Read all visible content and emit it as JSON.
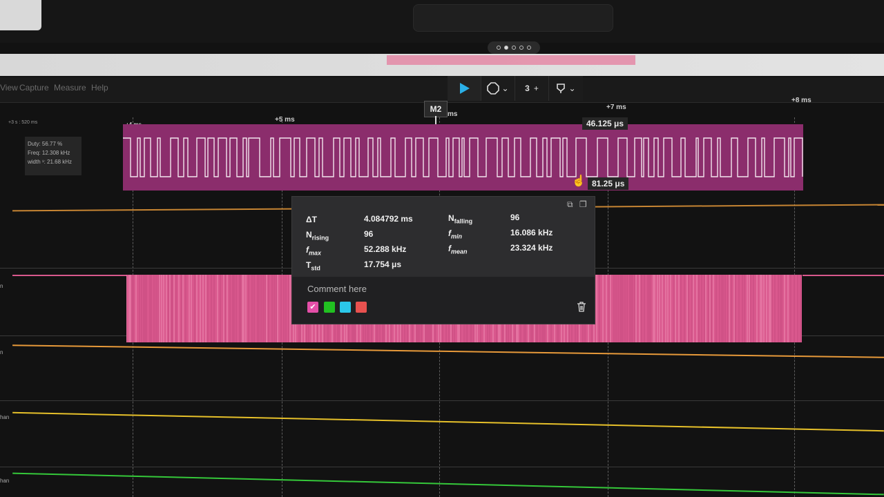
{
  "menu": [
    "View",
    "Capture",
    "Measure",
    "Help"
  ],
  "toolbar": {
    "trigger_label": "ᵀ",
    "step_label": "3",
    "plus_label": "+",
    "chevron": "⌄"
  },
  "ruler": {
    "ticks": [
      "+4 ms",
      "+5 ms",
      "ms",
      "+7 ms",
      "+8 ms"
    ],
    "left_label": "+3 s : 520 ms"
  },
  "marker": {
    "label": "M2"
  },
  "measurements": {
    "pulse_width": "46.125 μs",
    "period": "81.25 μs"
  },
  "left_box": {
    "duty": "Duty: 56.77 %",
    "freq": "Freq: 12.308 kHz",
    "width": "width ¹: 21.68 kHz"
  },
  "popup": {
    "delta_t_label": "ΔT",
    "delta_t": "4.084792 ms",
    "n_falling_label": "N",
    "n_falling_sub": "falling",
    "n_falling": "96",
    "n_rising_label": "N",
    "n_rising_sub": "rising",
    "n_rising": "96",
    "f_min_label": "f",
    "f_min_sub": "min",
    "f_min": "16.086 kHz",
    "f_max_label": "f",
    "f_max_sub": "max",
    "f_max": "52.288 kHz",
    "f_mean_label": "f",
    "f_mean_sub": "mean",
    "f_mean": "23.324 kHz",
    "t_std_label": "T",
    "t_std_sub": "std",
    "t_std": "17.754 μs",
    "comment_placeholder": "Comment here",
    "colors": [
      "#e44fa8",
      "#21c021",
      "#2bc7e8",
      "#e8514f"
    ]
  },
  "side_labels": [
    "n",
    "n",
    "han",
    "han"
  ],
  "colors": {
    "ch0_band": "#8b2d6c",
    "ch1_band": "#d9588d",
    "trace_orange": "#e89a3a",
    "trace_yellow": "#e7c12a",
    "trace_green": "#35c93a",
    "play": "#2bb0e8"
  }
}
